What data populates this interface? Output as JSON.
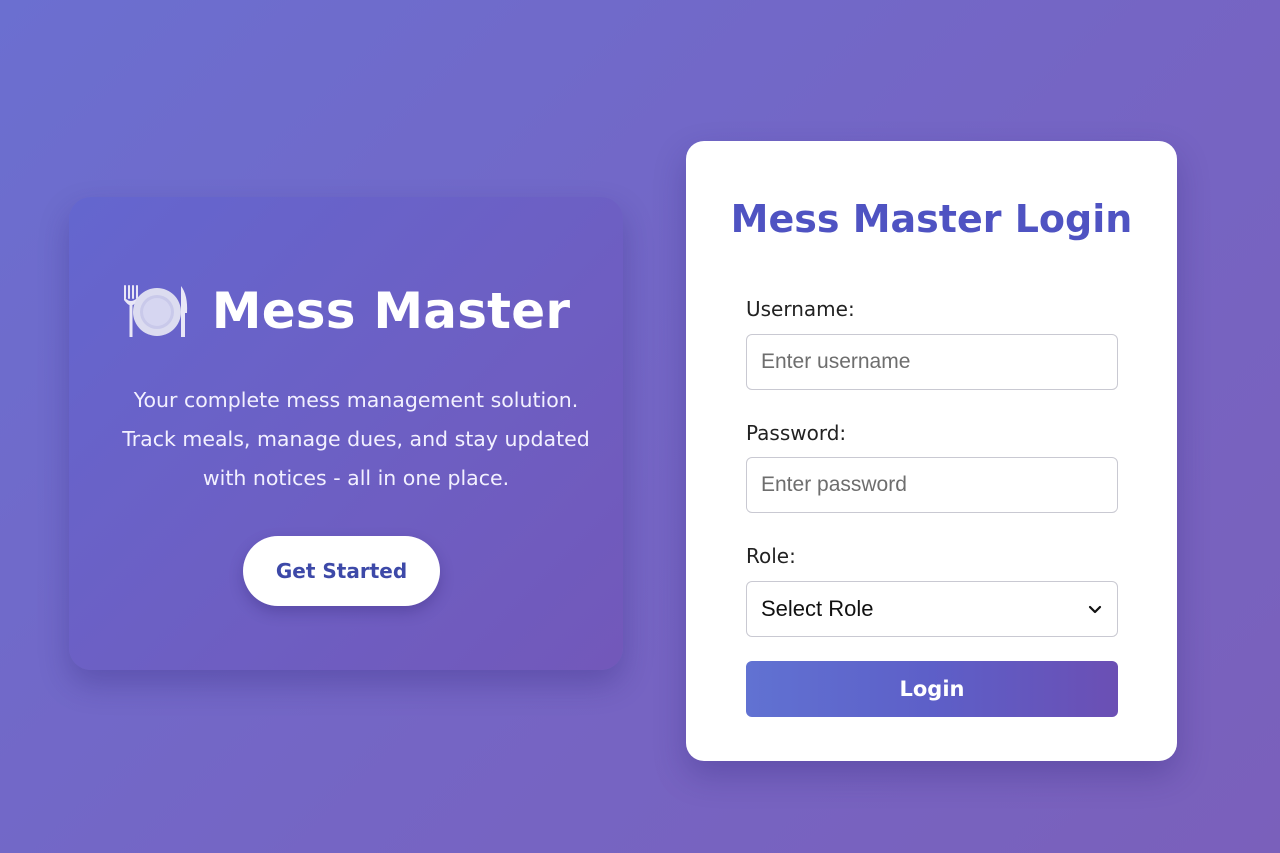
{
  "hero": {
    "icon": "fork-knife-plate-icon",
    "title": "Mess Master",
    "description": [
      "Your complete mess management solution.",
      "Track meals, manage dues, and stay updated",
      "with notices - all in one place."
    ],
    "cta_label": "Get Started"
  },
  "login": {
    "title": "Mess Master Login",
    "username_label": "Username:",
    "username_placeholder": "Enter username",
    "username_value": "",
    "password_label": "Password:",
    "password_placeholder": "Enter password",
    "password_value": "",
    "role_label": "Role:",
    "role_selected": "Select Role",
    "role_icon": "chevron-down-icon",
    "submit_label": "Login"
  },
  "colors": {
    "background_start": "#6b6fd0",
    "background_end": "#7a60bb",
    "login_title": "#4f53c2",
    "cta_text": "#3d49a8",
    "login_button_start": "#6172d2",
    "login_button_end": "#6b4fb4"
  }
}
